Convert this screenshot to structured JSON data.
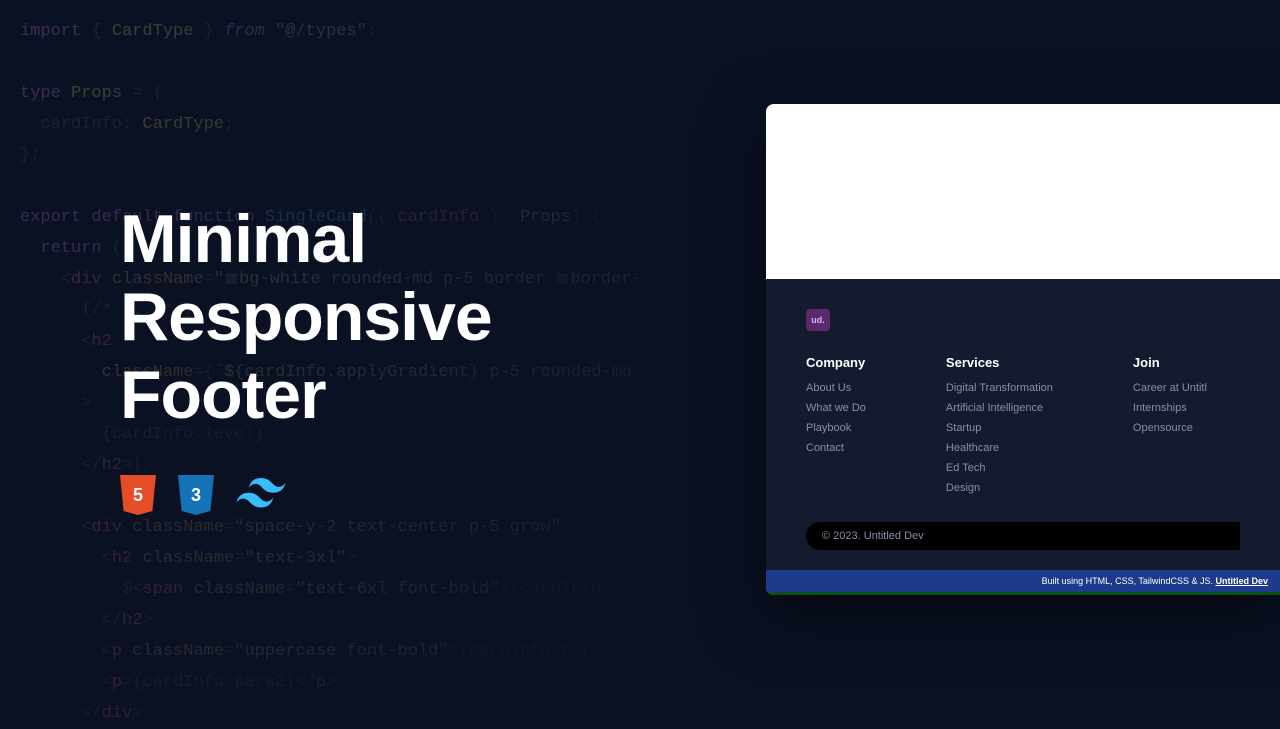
{
  "code": {
    "l1": "import { CardType } from \"@/types\";",
    "l3": "type Props = {",
    "l4": "  cardInfo: CardType;",
    "l5": "};",
    "l7": "export default function SingleCard({ cardInfo }: Props) {",
    "l8": "  return (",
    "l9a": "    <div className=\"",
    "l9b": "bg-white rounded-md p-5 border ",
    "l9c": "border-",
    "l10": "      {/* ... */}",
    "l11": "      <h2",
    "l12a": "        className={`${cardInfo.applyGradient}",
    "l12b": " p-5 rounded-md",
    "l13": "      >",
    "l14": "        {cardInfo.level}",
    "l15": "      </h2>",
    "l17": "      <div className=\"space-y-2 text-center p-5 grow\">",
    "l18": "        <h2 className=\"text-3xl\">",
    "l19": "          $<span className=\"text-6xl font-bold\">{cardInfo",
    "l20": "        </h2>",
    "l21": "        <p className=\"uppercase font-bold\">{cardInfo.par",
    "l22": "        <p>{cardInfo.para2}</p>",
    "l23": "      </div>"
  },
  "headline": {
    "l1": "Minimal",
    "l2": "Responsive",
    "l3": "Footer"
  },
  "icons": {
    "html5": "5",
    "css3": "3"
  },
  "preview": {
    "logo": "ud.",
    "company": {
      "title": "Company",
      "links": [
        "About Us",
        "What we Do",
        "Playbook",
        "Contact"
      ]
    },
    "services": {
      "title": "Services",
      "links": [
        "Digital Transformation",
        "Artificial Intelligence",
        "Startup",
        "Healthcare",
        "Ed Tech",
        "Design"
      ]
    },
    "join": {
      "title": "Join",
      "links": [
        "Career at Untitl",
        "Internships",
        "Opensource"
      ]
    },
    "copyright": "© 2023. Untitled Dev",
    "built": "Built using HTML, CSS, TailwindCSS & JS.",
    "built_link": "Untitled Dev"
  }
}
